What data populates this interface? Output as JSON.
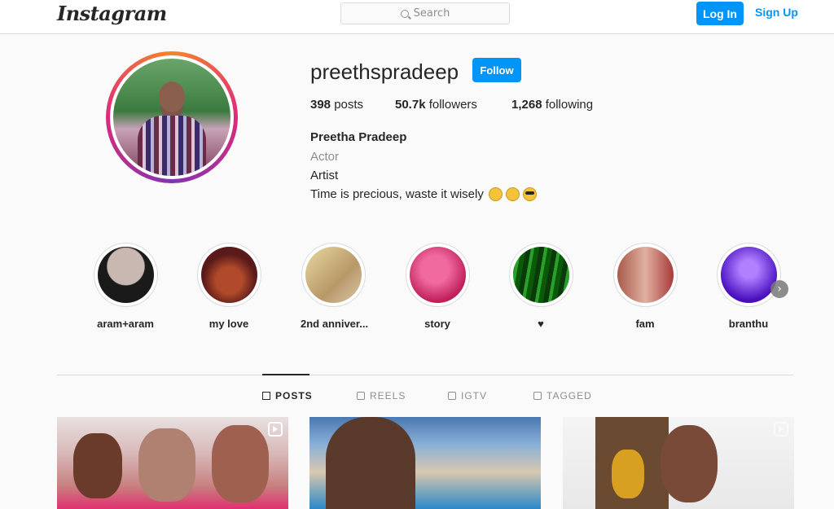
{
  "topbar": {
    "logo": "Instagram",
    "search_placeholder": "Search",
    "login_label": "Log In",
    "signup_label": "Sign Up"
  },
  "profile": {
    "username": "preethspradeep",
    "follow_label": "Follow",
    "stats": {
      "posts_count": "398",
      "posts_label": "posts",
      "followers_count": "50.7k",
      "followers_label": "followers",
      "following_count": "1,268",
      "following_label": "following"
    },
    "full_name": "Preetha Pradeep",
    "category": "Actor",
    "bio_line1": "Artist",
    "bio_line2": "Time is precious, waste it wisely",
    "bio_emojis": [
      "wink-emoji",
      "smile-emoji",
      "sunglasses-emoji"
    ]
  },
  "highlights": [
    {
      "label": "aram+aram",
      "color": "#c9b8b2"
    },
    {
      "label": "my love",
      "color": "#8a3a2a"
    },
    {
      "label": "2nd anniver...",
      "color": "#d8c28a"
    },
    {
      "label": "story",
      "color": "#e0357a"
    },
    {
      "label": "♥",
      "color": "#1f8a2a"
    },
    {
      "label": "fam",
      "color": "#b06a5a"
    },
    {
      "label": "branthu",
      "color": "#5a2ad0"
    }
  ],
  "tabs": [
    {
      "label": "POSTS",
      "active": true
    },
    {
      "label": "REELS",
      "active": false
    },
    {
      "label": "IGTV",
      "active": false
    },
    {
      "label": "TAGGED",
      "active": false
    }
  ],
  "colors": {
    "accent": "#0095f6",
    "border": "#dbdbdb",
    "muted": "#8e8e8e"
  }
}
